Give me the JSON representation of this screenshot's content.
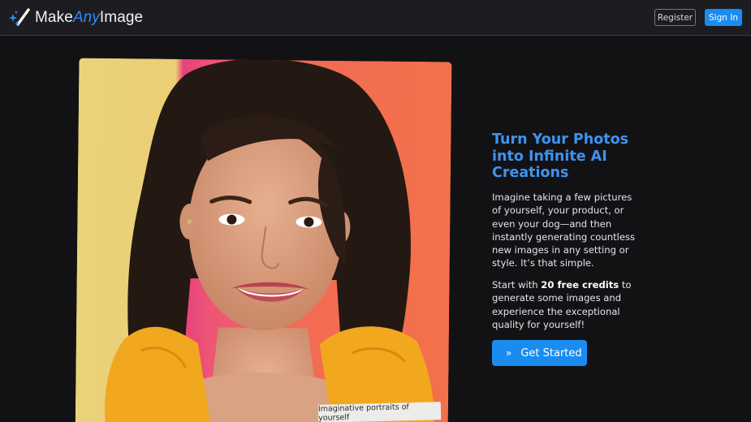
{
  "header": {
    "logo": {
      "make": "Make",
      "any": "Any",
      "image": "Image",
      "icon": "magic-wand-sparkle-icon"
    },
    "register_label": "Register",
    "signin_label": "Sign In"
  },
  "hero": {
    "title": "Turn Your Photos into Infinite AI Creations",
    "description": "Imagine taking a few pictures of yourself, your product, or even your dog—and then instantly generating countless new images in any setting or style. It’s that simple.",
    "credits_prefix": "Start with ",
    "credits_bold": "20 free credits",
    "credits_suffix": " to generate some images and experience the exceptional quality for yourself!",
    "cta_icon": "double-chevron-right-icon",
    "cta_label": "Get Started"
  },
  "showcase": {
    "caption": "Imaginative portraits of yourself"
  },
  "colors": {
    "accent": "#1a8cf0",
    "title": "#3d93f0",
    "background": "#121215",
    "navbar": "#1d1d21"
  }
}
